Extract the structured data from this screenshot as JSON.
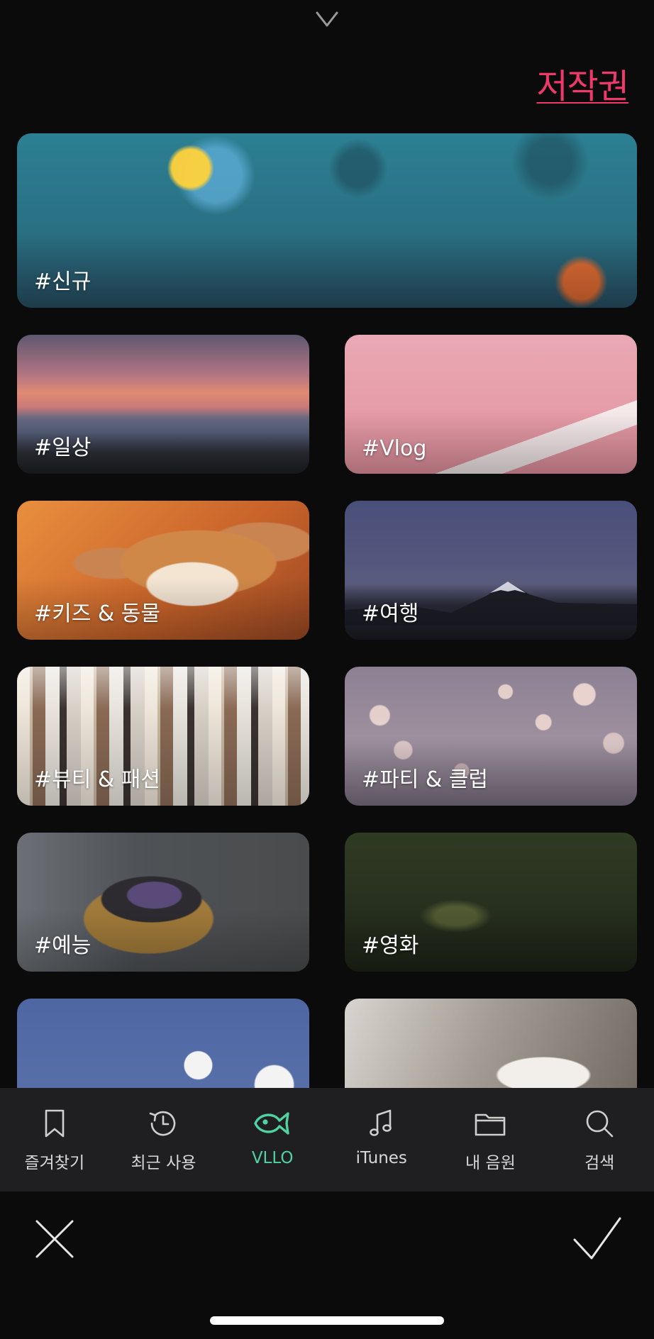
{
  "header": {
    "collapse_icon": "chevron-down-icon",
    "copyright_label": "저작권"
  },
  "categories": [
    {
      "label": "#신규"
    },
    {
      "label": "#일상"
    },
    {
      "label": "#Vlog"
    },
    {
      "label": "#키즈 & 동물"
    },
    {
      "label": "#여행"
    },
    {
      "label": "#뷰티 & 패션"
    },
    {
      "label": "#파티 & 클럽"
    },
    {
      "label": "#예능"
    },
    {
      "label": "#영화"
    },
    {
      "label": ""
    },
    {
      "label": ""
    }
  ],
  "tabbar": {
    "items": [
      {
        "label": "즐겨찾기",
        "icon": "bookmark-icon"
      },
      {
        "label": "최근 사용",
        "icon": "history-icon"
      },
      {
        "label": "VLLO",
        "icon": "vllo-fish-icon"
      },
      {
        "label": "iTunes",
        "icon": "music-note-icon"
      },
      {
        "label": "내 음원",
        "icon": "folder-icon"
      },
      {
        "label": "검색",
        "icon": "search-icon"
      }
    ],
    "active_index": 2
  },
  "footer": {
    "cancel_icon": "close-icon",
    "confirm_icon": "checkmark-icon"
  },
  "colors": {
    "background": "#0b0b0c",
    "accent_link": "#f0386b",
    "active_tab": "#4fd3a0",
    "tabbar_bg": "#1f1f21"
  }
}
